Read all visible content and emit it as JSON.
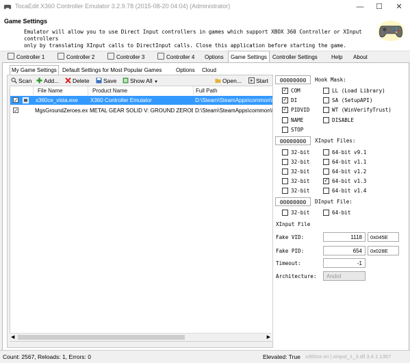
{
  "window": {
    "title": "TocaEdit X360 Controller Emulator 3.2.9.78 (2015-08-20 04:04) (Administrator)",
    "min_glyph": "—",
    "max_glyph": "☐",
    "close_glyph": "✕"
  },
  "header": {
    "title": "Game Settings",
    "description_line1": "Emulator will allow you to use Direct Input controllers in games which support XBOX 360 Controller or XInput controllers",
    "description_line2": "only by translating XInput calls to DirectInput calls. Close this application before starting the game.",
    "icon": "gamepad-icon"
  },
  "tabs": [
    "Controller 1",
    "Controller 2",
    "Controller 3",
    "Controller 4",
    "Options",
    "Game Settings",
    "Controller Settings",
    "Help",
    "About"
  ],
  "active_tab": "Game Settings",
  "subtabs": [
    "My Game Settings",
    "Default Settings for Most Popular Games",
    "Options",
    "Cloud"
  ],
  "toolbar": {
    "scan": "Scan",
    "add": "Add...",
    "delete": "Delete",
    "save": "Save",
    "show_all": "Show All",
    "open": "Open...",
    "start": "Start"
  },
  "list": {
    "columns": [
      "File Name",
      "Product Name",
      "Full Path"
    ],
    "rows": [
      {
        "checked": true,
        "selected": true,
        "file": "x360ce_vista.exe",
        "product": "X360 Controller Emulator",
        "path": "D:\\Steam\\SteamApps\\common\\Me..."
      },
      {
        "checked": true,
        "selected": false,
        "file": "MgsGroundZeroes.exe",
        "product": "METAL GEAR SOLID V: GROUND ZEROES",
        "path": "D:\\Steam\\SteamApps\\common\\Me..."
      }
    ]
  },
  "hook": {
    "mask_value": "00000000",
    "mask_label": "Hook Mask:",
    "options": [
      {
        "label": "COM",
        "checked": true
      },
      {
        "label": "LL (Load Library)",
        "checked": false
      },
      {
        "label": "DI",
        "checked": true
      },
      {
        "label": "SA (SetupAPI)",
        "checked": false
      },
      {
        "label": "PIDVID",
        "checked": true
      },
      {
        "label": "WT (WinVerifyTrust)",
        "checked": false
      },
      {
        "label": "NAME",
        "checked": false
      },
      {
        "label": "DISABLE",
        "checked": false
      },
      {
        "label": "STOP",
        "checked": false
      }
    ]
  },
  "xinput_files": {
    "value": "00000000",
    "label": "XInput Files:",
    "items": [
      {
        "label": "32-bit",
        "checked": false
      },
      {
        "label": "64-bit v9.1",
        "checked": false
      },
      {
        "label": "32-bit",
        "checked": false
      },
      {
        "label": "64-bit v1.1",
        "checked": false
      },
      {
        "label": "32-bit",
        "checked": false
      },
      {
        "label": "64-bit v1.2",
        "checked": false
      },
      {
        "label": "32-bit",
        "checked": false
      },
      {
        "label": "64-bit v1.3",
        "checked": true
      },
      {
        "label": "32-bit",
        "checked": false
      },
      {
        "label": "64-bit v1.4",
        "checked": false
      }
    ]
  },
  "dinput_file": {
    "value": "00000000",
    "label": "DInput File:",
    "items": [
      {
        "label": "32-bit",
        "checked": false
      },
      {
        "label": "64-bit",
        "checked": false
      }
    ]
  },
  "xinput_file_label": "XInput File",
  "fake_vid": {
    "label": "Fake VID:",
    "value": "1118",
    "hex": "0x045E"
  },
  "fake_pid": {
    "label": "Fake PID:",
    "value": "654",
    "hex": "0x028E"
  },
  "timeout": {
    "label": "Timeout:",
    "value": "-1"
  },
  "architecture": {
    "label": "Architecture:",
    "value": "Andrd"
  },
  "status": {
    "count": "Count: 2567, Reloads: 1, Errors: 0",
    "elevated": "Elevated: True",
    "extra": "x360ce.ini | xinput_1_3.dll 3.4.1.1357"
  },
  "colors": {
    "selection": "#3399ff",
    "panel": "#f0f0f0"
  }
}
